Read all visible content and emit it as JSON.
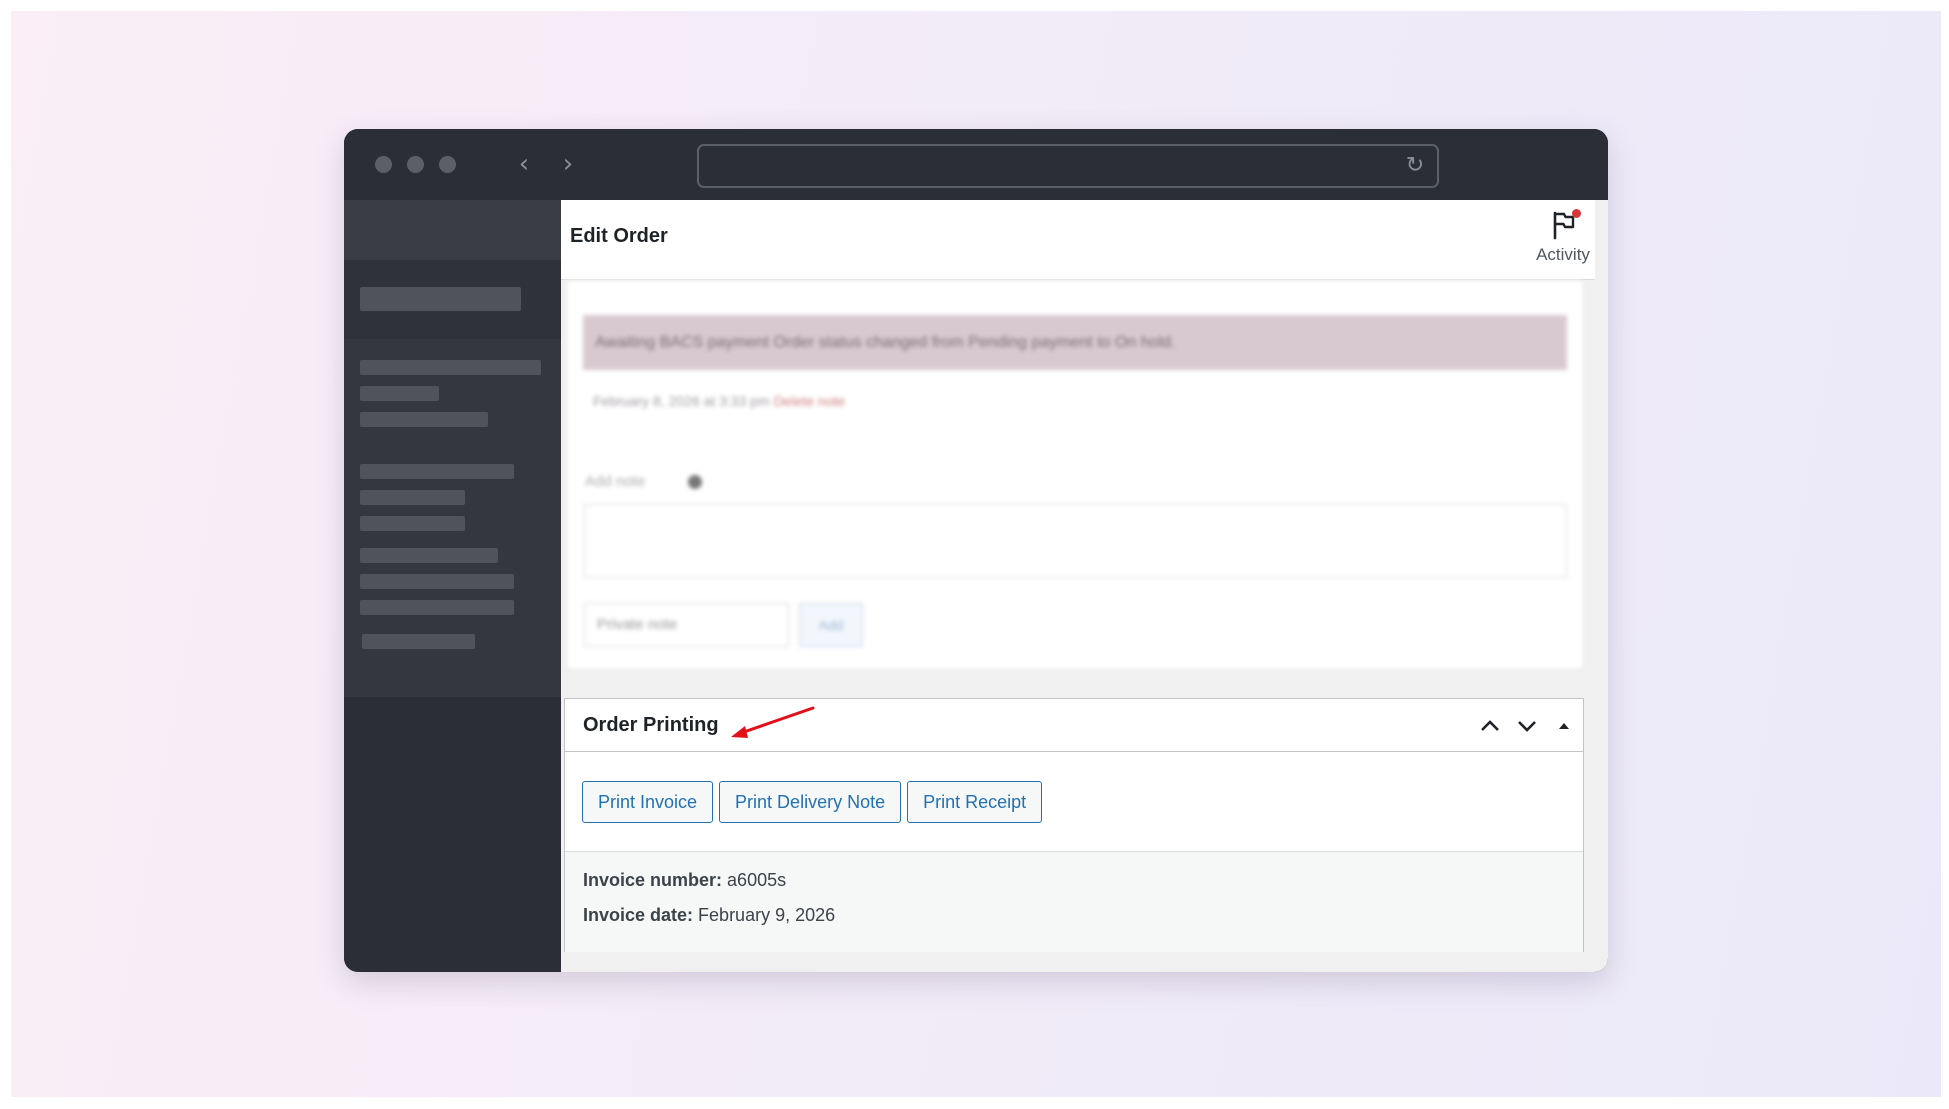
{
  "header": {
    "title": "Edit Order",
    "activity_label": "Activity"
  },
  "notes": {
    "note_text": "Awaiting BACS payment Order status changed from Pending payment to On hold.",
    "note_date": "February 8, 2026 at 3:33 pm",
    "delete_label": "Delete note",
    "add_note_label": "Add note",
    "note_type": "Private note",
    "add_button": "Add"
  },
  "order_printing": {
    "title": "Order Printing",
    "buttons": [
      "Print Invoice",
      "Print Delivery Note",
      "Print Receipt"
    ],
    "invoice_number_label": "Invoice number:",
    "invoice_number": "a6005s",
    "invoice_date_label": "Invoice date:",
    "invoice_date": "February 9, 2026"
  },
  "colors": {
    "accent": "#2271b1",
    "annotation_arrow": "#e3101a",
    "notification": "#d63638"
  }
}
